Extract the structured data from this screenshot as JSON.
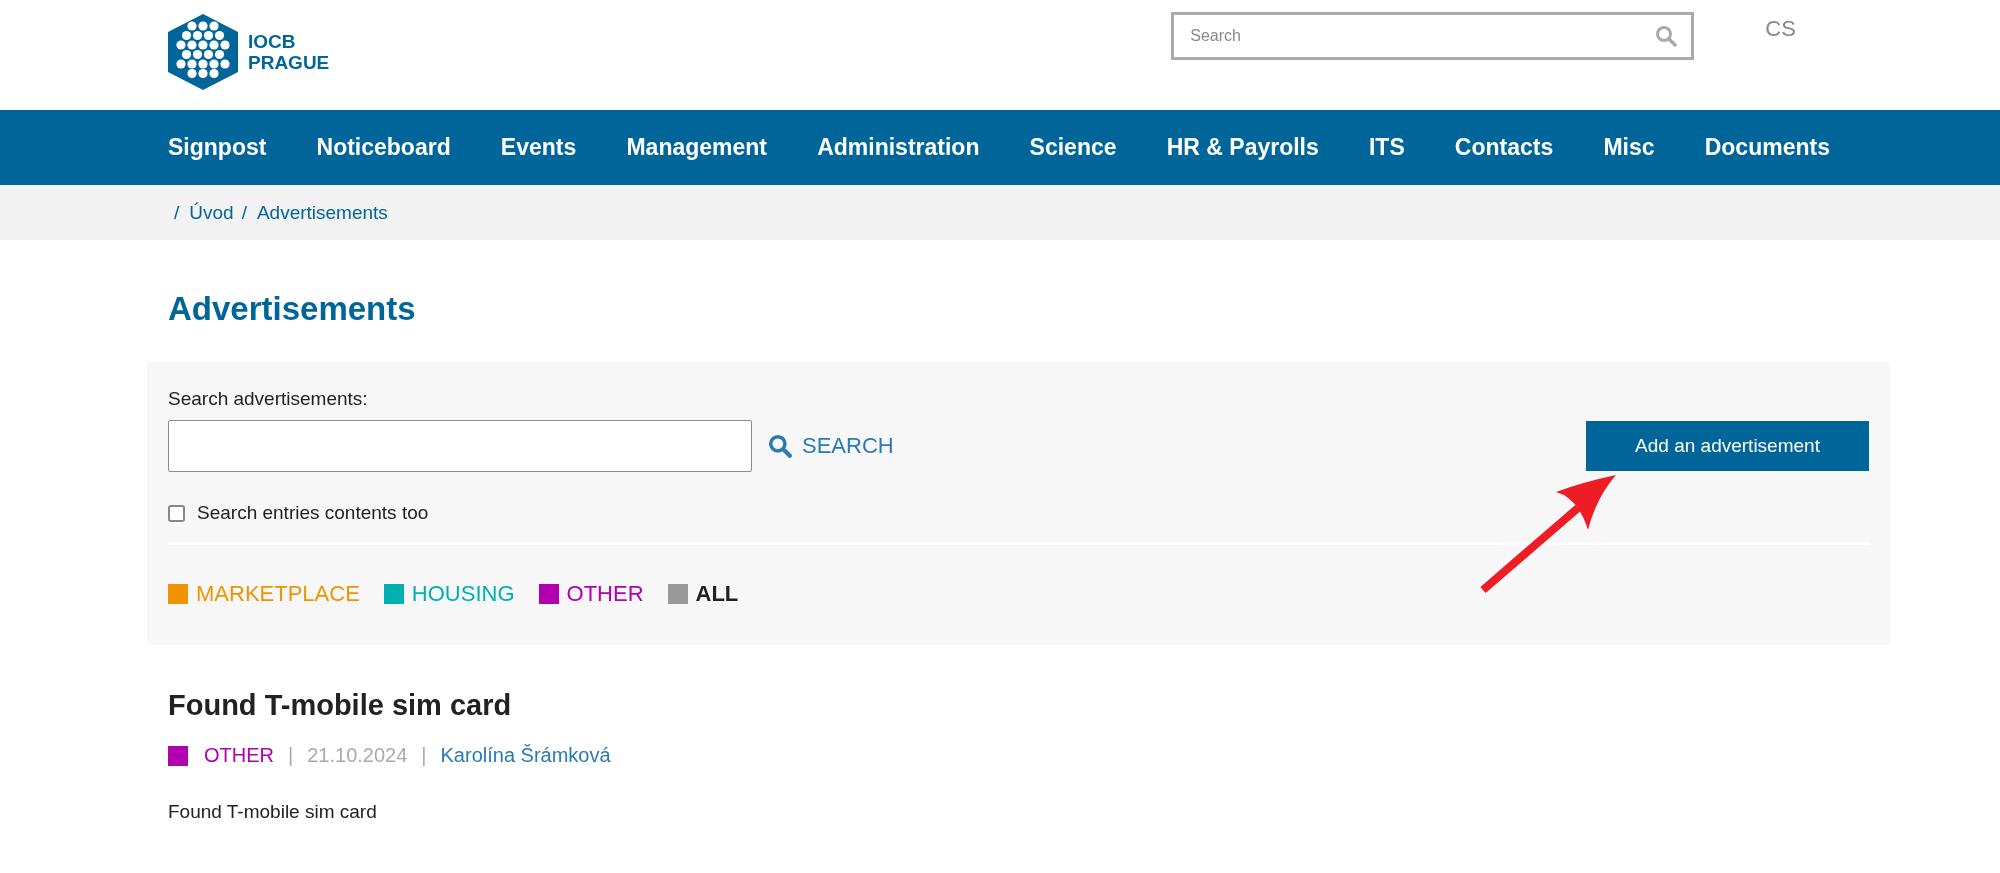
{
  "logo": {
    "line1": "IOCB",
    "line2": "PRAGUE"
  },
  "site_search": {
    "placeholder": "Search"
  },
  "language": "CS",
  "nav": [
    {
      "label": "Signpost"
    },
    {
      "label": "Noticeboard"
    },
    {
      "label": "Events"
    },
    {
      "label": "Management"
    },
    {
      "label": "Administration"
    },
    {
      "label": "Science"
    },
    {
      "label": "HR & Payrolls"
    },
    {
      "label": "ITS"
    },
    {
      "label": "Contacts"
    },
    {
      "label": "Misc"
    },
    {
      "label": "Documents"
    }
  ],
  "breadcrumb": [
    {
      "separator": "/",
      "label": "Úvod"
    },
    {
      "separator": "/",
      "label": "Advertisements"
    }
  ],
  "heading": "Advertisements",
  "filter_panel": {
    "search_label": "Search advertisements:",
    "search_button": "SEARCH",
    "add_button": "Add an advertisement",
    "contents_checkbox": {
      "label": "Search entries contents too",
      "checked": false
    },
    "categories": [
      {
        "label": "MARKETPLACE",
        "color": "#ef9400",
        "selected": false
      },
      {
        "label": "HOUSING",
        "color": "#00b0b0",
        "selected": false
      },
      {
        "label": "OTHER",
        "color": "#b000b0",
        "selected": false
      },
      {
        "label": "ALL",
        "color": "#999999",
        "selected": true
      }
    ]
  },
  "advertisements": [
    {
      "title": "Found T-mobile sim card",
      "category": "OTHER",
      "color": "#b000b0",
      "date": "21.10.2024",
      "separators": [
        "|",
        "|"
      ],
      "author": "Karolína Šrámková",
      "body": "Found T-mobile sim card"
    }
  ]
}
